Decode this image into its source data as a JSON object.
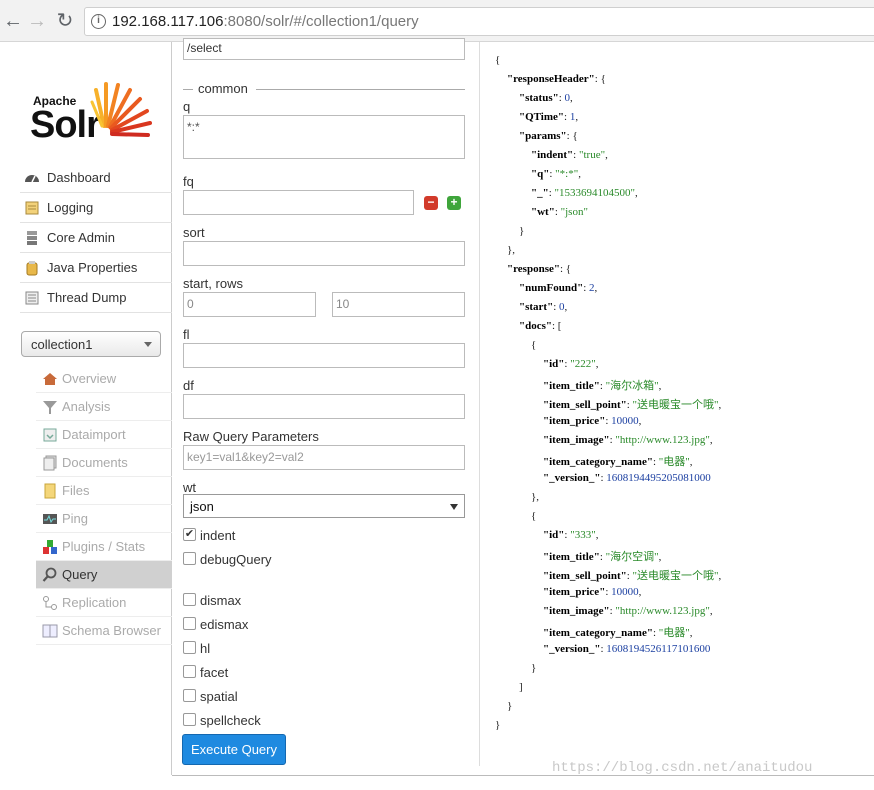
{
  "browser": {
    "back": "←",
    "forward": "→",
    "reload": "↻",
    "info": "i",
    "url_host": "192.168.117.106",
    "url_rest": ":8080/solr/#/collection1/query"
  },
  "sidebar": {
    "logo_apache": "Apache",
    "logo_solr": "Solr",
    "items": [
      {
        "label": "Dashboard",
        "icon": "dashboard-icon"
      },
      {
        "label": "Logging",
        "icon": "logging-icon"
      },
      {
        "label": "Core Admin",
        "icon": "core-admin-icon"
      },
      {
        "label": "Java Properties",
        "icon": "java-icon"
      },
      {
        "label": "Thread Dump",
        "icon": "thread-dump-icon"
      }
    ],
    "core_selector": "collection1",
    "core_items": [
      {
        "label": "Overview"
      },
      {
        "label": "Analysis"
      },
      {
        "label": "Dataimport"
      },
      {
        "label": "Documents"
      },
      {
        "label": "Files"
      },
      {
        "label": "Ping"
      },
      {
        "label": "Plugins / Stats"
      },
      {
        "label": "Query"
      },
      {
        "label": "Replication"
      },
      {
        "label": "Schema Browser"
      }
    ]
  },
  "form": {
    "handler": "/select",
    "common_legend": "common",
    "q_label": "q",
    "q_value": "*:*",
    "fq_label": "fq",
    "fq_minus": "−",
    "fq_plus": "+",
    "sort_label": "sort",
    "start_rows_label": "start, rows",
    "start_value": "0",
    "rows_value": "10",
    "fl_label": "fl",
    "df_label": "df",
    "raw_label": "Raw Query Parameters",
    "raw_placeholder": "key1=val1&key2=val2",
    "wt_label": "wt",
    "wt_value": "json",
    "indent_label": "indent",
    "indent_check": "✔",
    "debug_label": "debugQuery",
    "dismax_label": "dismax",
    "edismax_label": "edismax",
    "hl_label": "hl",
    "facet_label": "facet",
    "spatial_label": "spatial",
    "spellcheck_label": "spellcheck",
    "execute_label": "Execute Query"
  },
  "result": {
    "lines": [
      {
        "indent": 0,
        "parts": [
          {
            "t": "p",
            "v": "{"
          }
        ]
      },
      {
        "indent": 1,
        "parts": [
          {
            "t": "k",
            "v": "\"responseHeader\""
          },
          {
            "t": "p",
            "v": ": {"
          }
        ]
      },
      {
        "indent": 2,
        "parts": [
          {
            "t": "k",
            "v": "\"status\""
          },
          {
            "t": "p",
            "v": ": "
          },
          {
            "t": "n",
            "v": "0"
          },
          {
            "t": "p",
            "v": ","
          }
        ]
      },
      {
        "indent": 2,
        "parts": [
          {
            "t": "k",
            "v": "\"QTime\""
          },
          {
            "t": "p",
            "v": ": "
          },
          {
            "t": "n",
            "v": "1"
          },
          {
            "t": "p",
            "v": ","
          }
        ]
      },
      {
        "indent": 2,
        "parts": [
          {
            "t": "k",
            "v": "\"params\""
          },
          {
            "t": "p",
            "v": ": {"
          }
        ]
      },
      {
        "indent": 3,
        "parts": [
          {
            "t": "k",
            "v": "\"indent\""
          },
          {
            "t": "p",
            "v": ": "
          },
          {
            "t": "s",
            "v": "\"true\""
          },
          {
            "t": "p",
            "v": ","
          }
        ]
      },
      {
        "indent": 3,
        "parts": [
          {
            "t": "k",
            "v": "\"q\""
          },
          {
            "t": "p",
            "v": ": "
          },
          {
            "t": "s",
            "v": "\"*:*\""
          },
          {
            "t": "p",
            "v": ","
          }
        ]
      },
      {
        "indent": 3,
        "parts": [
          {
            "t": "k",
            "v": "\"_\""
          },
          {
            "t": "p",
            "v": ": "
          },
          {
            "t": "s",
            "v": "\"1533694104500\""
          },
          {
            "t": "p",
            "v": ","
          }
        ]
      },
      {
        "indent": 3,
        "parts": [
          {
            "t": "k",
            "v": "\"wt\""
          },
          {
            "t": "p",
            "v": ": "
          },
          {
            "t": "s",
            "v": "\"json\""
          }
        ]
      },
      {
        "indent": 2,
        "parts": [
          {
            "t": "p",
            "v": "}"
          }
        ]
      },
      {
        "indent": 1,
        "parts": [
          {
            "t": "p",
            "v": "},"
          }
        ]
      },
      {
        "indent": 1,
        "parts": [
          {
            "t": "k",
            "v": "\"response\""
          },
          {
            "t": "p",
            "v": ": {"
          }
        ]
      },
      {
        "indent": 2,
        "parts": [
          {
            "t": "k",
            "v": "\"numFound\""
          },
          {
            "t": "p",
            "v": ": "
          },
          {
            "t": "n",
            "v": "2"
          },
          {
            "t": "p",
            "v": ","
          }
        ]
      },
      {
        "indent": 2,
        "parts": [
          {
            "t": "k",
            "v": "\"start\""
          },
          {
            "t": "p",
            "v": ": "
          },
          {
            "t": "n",
            "v": "0"
          },
          {
            "t": "p",
            "v": ","
          }
        ]
      },
      {
        "indent": 2,
        "parts": [
          {
            "t": "k",
            "v": "\"docs\""
          },
          {
            "t": "p",
            "v": ": ["
          }
        ]
      },
      {
        "indent": 3,
        "parts": [
          {
            "t": "p",
            "v": "{"
          }
        ]
      },
      {
        "indent": 4,
        "parts": [
          {
            "t": "k",
            "v": "\"id\""
          },
          {
            "t": "p",
            "v": ": "
          },
          {
            "t": "s",
            "v": "\"222\""
          },
          {
            "t": "p",
            "v": ","
          }
        ]
      },
      {
        "indent": 4,
        "parts": [
          {
            "t": "k",
            "v": "\"item_title\""
          },
          {
            "t": "p",
            "v": ": "
          },
          {
            "t": "s",
            "v": "\"海尔冰箱\""
          },
          {
            "t": "p",
            "v": ","
          }
        ]
      },
      {
        "indent": 4,
        "parts": [
          {
            "t": "k",
            "v": "\"item_sell_point\""
          },
          {
            "t": "p",
            "v": ": "
          },
          {
            "t": "s",
            "v": "\"送电暖宝一个哦\""
          },
          {
            "t": "p",
            "v": ","
          }
        ]
      },
      {
        "indent": 4,
        "parts": [
          {
            "t": "k",
            "v": "\"item_price\""
          },
          {
            "t": "p",
            "v": ": "
          },
          {
            "t": "n",
            "v": "10000"
          },
          {
            "t": "p",
            "v": ","
          }
        ]
      },
      {
        "indent": 4,
        "parts": [
          {
            "t": "k",
            "v": "\"item_image\""
          },
          {
            "t": "p",
            "v": ": "
          },
          {
            "t": "s",
            "v": "\"http://www.123.jpg\""
          },
          {
            "t": "p",
            "v": ","
          }
        ]
      },
      {
        "indent": 4,
        "parts": [
          {
            "t": "k",
            "v": "\"item_category_name\""
          },
          {
            "t": "p",
            "v": ": "
          },
          {
            "t": "s",
            "v": "\"电器\""
          },
          {
            "t": "p",
            "v": ","
          }
        ]
      },
      {
        "indent": 4,
        "parts": [
          {
            "t": "k",
            "v": "\"_version_\""
          },
          {
            "t": "p",
            "v": ": "
          },
          {
            "t": "n",
            "v": "1608194495205081000"
          }
        ]
      },
      {
        "indent": 3,
        "parts": [
          {
            "t": "p",
            "v": "},"
          }
        ]
      },
      {
        "indent": 3,
        "parts": [
          {
            "t": "p",
            "v": "{"
          }
        ]
      },
      {
        "indent": 4,
        "parts": [
          {
            "t": "k",
            "v": "\"id\""
          },
          {
            "t": "p",
            "v": ": "
          },
          {
            "t": "s",
            "v": "\"333\""
          },
          {
            "t": "p",
            "v": ","
          }
        ]
      },
      {
        "indent": 4,
        "parts": [
          {
            "t": "k",
            "v": "\"item_title\""
          },
          {
            "t": "p",
            "v": ": "
          },
          {
            "t": "s",
            "v": "\"海尔空调\""
          },
          {
            "t": "p",
            "v": ","
          }
        ]
      },
      {
        "indent": 4,
        "parts": [
          {
            "t": "k",
            "v": "\"item_sell_point\""
          },
          {
            "t": "p",
            "v": ": "
          },
          {
            "t": "s",
            "v": "\"送电暖宝一个哦\""
          },
          {
            "t": "p",
            "v": ","
          }
        ]
      },
      {
        "indent": 4,
        "parts": [
          {
            "t": "k",
            "v": "\"item_price\""
          },
          {
            "t": "p",
            "v": ": "
          },
          {
            "t": "n",
            "v": "10000"
          },
          {
            "t": "p",
            "v": ","
          }
        ]
      },
      {
        "indent": 4,
        "parts": [
          {
            "t": "k",
            "v": "\"item_image\""
          },
          {
            "t": "p",
            "v": ": "
          },
          {
            "t": "s",
            "v": "\"http://www.123.jpg\""
          },
          {
            "t": "p",
            "v": ","
          }
        ]
      },
      {
        "indent": 4,
        "parts": [
          {
            "t": "k",
            "v": "\"item_category_name\""
          },
          {
            "t": "p",
            "v": ": "
          },
          {
            "t": "s",
            "v": "\"电器\""
          },
          {
            "t": "p",
            "v": ","
          }
        ]
      },
      {
        "indent": 4,
        "parts": [
          {
            "t": "k",
            "v": "\"_version_\""
          },
          {
            "t": "p",
            "v": ": "
          },
          {
            "t": "n",
            "v": "1608194526117101600"
          }
        ]
      },
      {
        "indent": 3,
        "parts": [
          {
            "t": "p",
            "v": "}"
          }
        ]
      },
      {
        "indent": 2,
        "parts": [
          {
            "t": "p",
            "v": "]"
          }
        ]
      },
      {
        "indent": 1,
        "parts": [
          {
            "t": "p",
            "v": "}"
          }
        ]
      },
      {
        "indent": 0,
        "parts": [
          {
            "t": "p",
            "v": "}"
          }
        ]
      }
    ]
  },
  "watermark": "https://blog.csdn.net/anaitudou",
  "colors": {
    "execute_button": "#1f8ae0",
    "json_key": "#000000",
    "json_string": "#2a8a2a",
    "json_number": "#1a3ea0",
    "active_menu_bg": "#d0d0d0"
  }
}
